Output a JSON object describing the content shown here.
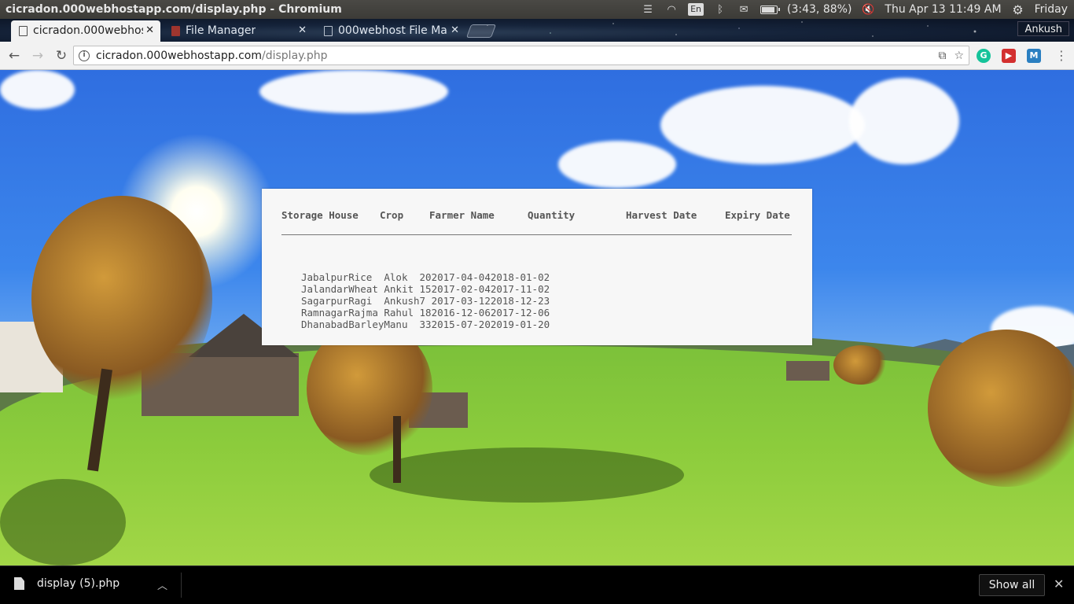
{
  "os": {
    "window_title": "cicradon.000webhostapp.com/display.php - Chromium",
    "keyboard_layout": "En",
    "battery": "(3:43, 88%)",
    "clock": "Thu Apr 13 11:49 AM",
    "user": "Friday"
  },
  "browser": {
    "tabs": [
      {
        "label": "cicradon.000webhos",
        "active": true
      },
      {
        "label": "File Manager",
        "active": false
      },
      {
        "label": "000webhost File Ma",
        "active": false
      }
    ],
    "profile_name": "Ankush",
    "url_host": "cicradon.000webhostapp.com",
    "url_path": "/display.php",
    "extensions": [
      "grammarly-icon",
      "red-extension-icon",
      "m-extension-icon"
    ]
  },
  "table": {
    "headers": [
      "Storage House",
      "Crop",
      "Farmer Name",
      "Quantity",
      "Harvest Date",
      "Expiry Date"
    ],
    "rows": [
      [
        "Jabalpur",
        "Rice",
        "Alok",
        "20",
        "2017-04-04",
        "2018-01-02"
      ],
      [
        "Jalandar",
        "Wheat",
        "Ankit",
        "15",
        "2017-02-04",
        "2017-11-02"
      ],
      [
        "Sagarpur",
        "Ragi",
        "Ankush",
        "7",
        "2017-03-12",
        "2018-12-23"
      ],
      [
        "Ramnagar",
        "Rajma",
        "Rahul",
        "18",
        "2016-12-06",
        "2017-12-06"
      ],
      [
        "Dhanabad",
        "Barley",
        "Manu",
        "33",
        "2015-07-20",
        "2019-01-20"
      ]
    ]
  },
  "downloads": {
    "file_name": "display (5).php",
    "show_all_label": "Show all"
  }
}
